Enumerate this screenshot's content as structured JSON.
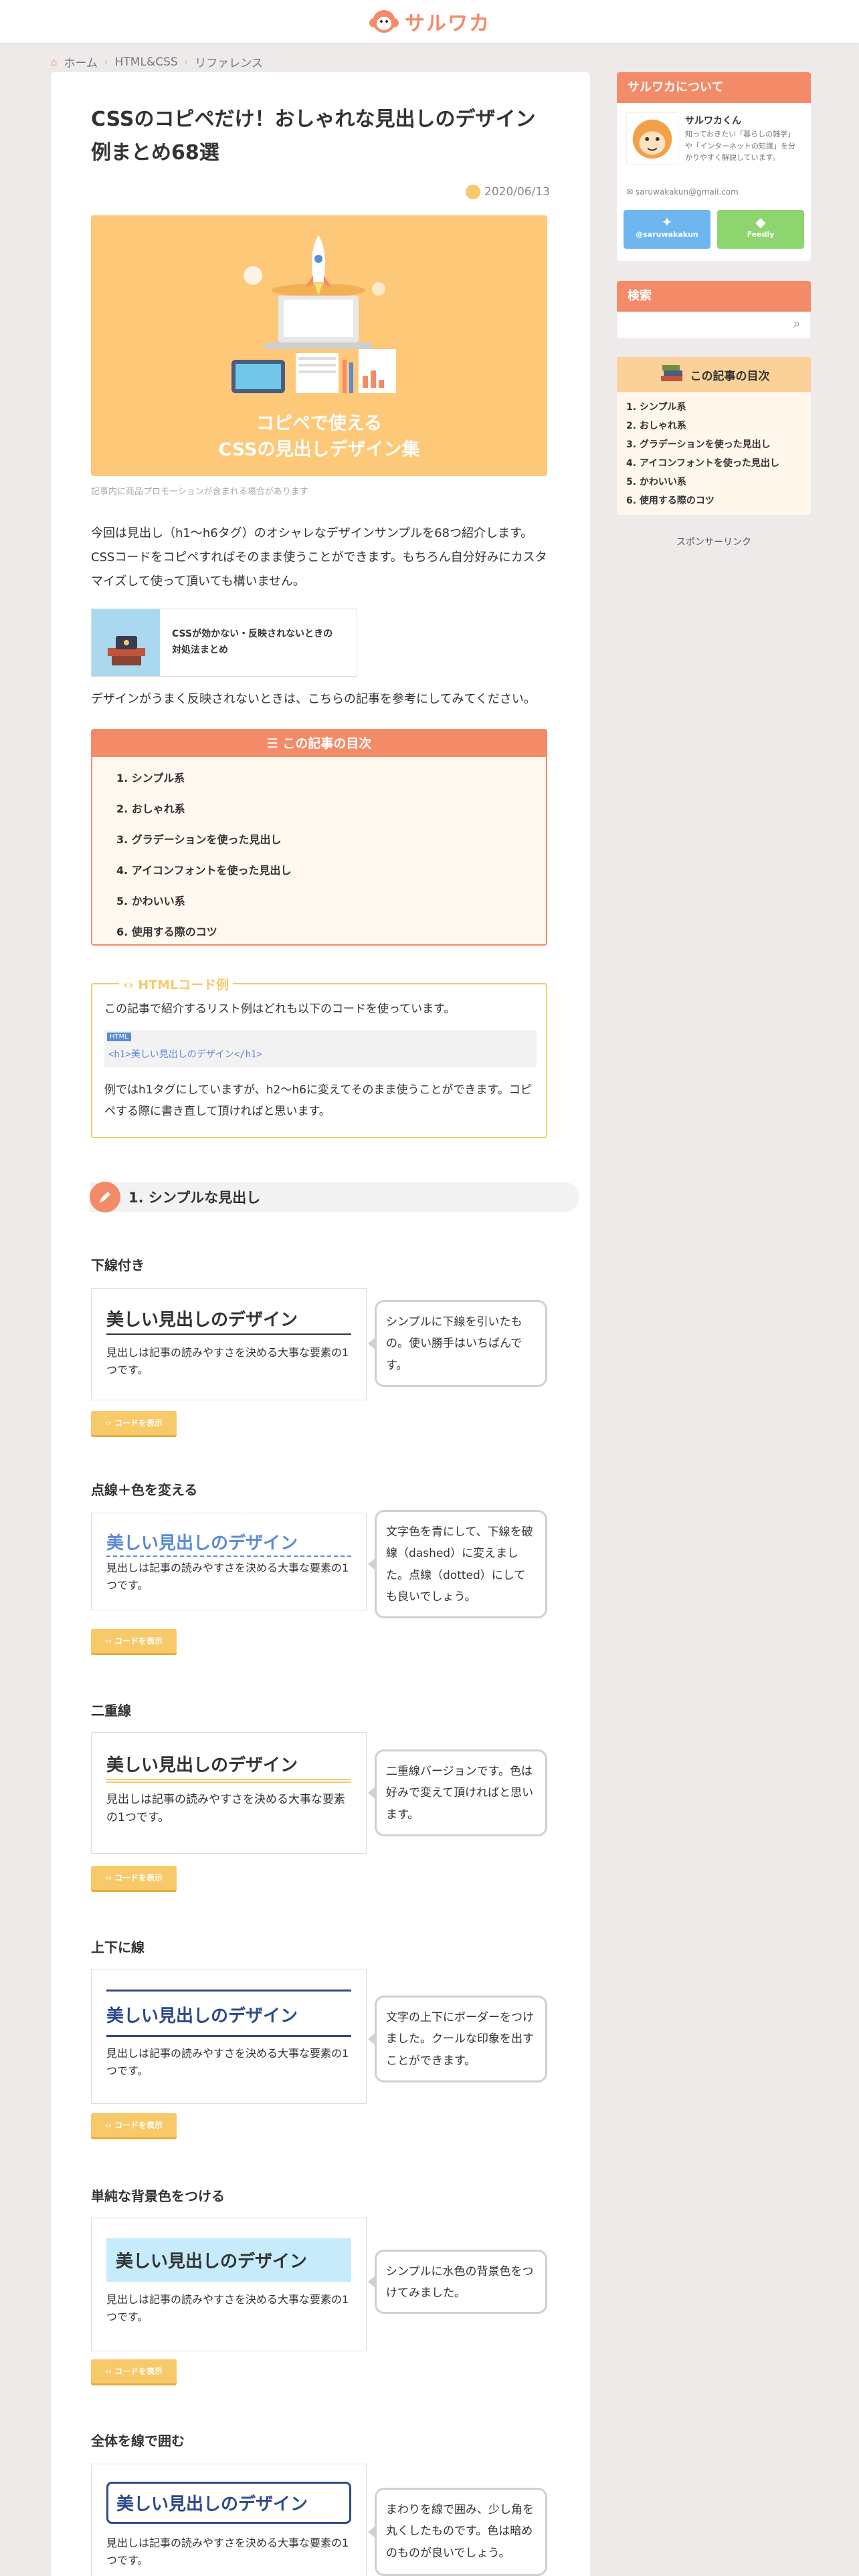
{
  "site": {
    "logo": "サルワカ"
  },
  "breadcrumb": [
    "ホーム",
    "HTML&CSS",
    "リファレンス"
  ],
  "article": {
    "title": "CSSのコピペだけ！おしゃれな見出しのデザイン例まとめ68選",
    "date": "2020/06/13",
    "hero_text": [
      "コピペで使える",
      "CSSの見出しデザイン集"
    ],
    "promo_note": "記事内に商品プロモーションが含まれる場合があります",
    "intro": "今回は見出し（h1〜h6タグ）のオシャレなデザインサンプルを68つ紹介します。CSSコードをコピペすればそのまま使うことができます。もちろん自分好みにカスタマイズして使って頂いても構いません。",
    "related_card": [
      "CSSが効かない・反映されないときの",
      "対処法まとめ"
    ],
    "related_note": "デザインがうまく反映されないときは、こちらの記事を参考にしてみてください。",
    "toc": {
      "heading": "この記事の目次",
      "items": [
        "1. シンプル系",
        "2. おしゃれ系",
        "3. グラデーションを使った見出し",
        "4. アイコンフォントを使った見出し",
        "5. かわいい系",
        "6. 使用する際のコツ"
      ]
    },
    "code_box": {
      "label": "HTMLコード例",
      "text": "この記事で紹介するリスト例はどれも以下のコードを使っています。",
      "tag": "HTML",
      "code": "<h1>美しい見出しのデザイン</h1>",
      "note": "例ではh1タグにしていますが、h2〜h6に変えてそのまま使うことができます。コピペする際に書き直して頂ければと思います。"
    },
    "section1": {
      "heading": "1. シンプルな見出し"
    },
    "demo_title": "美しい見出しのデザイン",
    "demo_text": "見出しは記事の読みやすさを決める大事な要素の1つです。",
    "button_label": "コードを表示",
    "examples": [
      {
        "heading": "下線付き",
        "bubble": "シンプルに下線を引いたもの。使い勝手はいちばんです。"
      },
      {
        "heading": "点線＋色を変える",
        "bubble": "文字色を青にして、下線を破線（dashed）に変えました。点線（dotted）にしても良いでしょう。"
      },
      {
        "heading": "二重線",
        "bubble": "二重線バージョンです。色は好みで変えて頂ければと思います。"
      },
      {
        "heading": "上下に線",
        "bubble": "文字の上下にボーダーをつけました。クールな印象を出すことができます。"
      },
      {
        "heading": "単純な背景色をつける",
        "bubble": "シンプルに水色の背景色をつけてみました。"
      },
      {
        "heading": "全体を線で囲む",
        "bubble": "まわりを線で囲み、少し角を丸くしたものです。色は暗めのものが良いでしょう。"
      }
    ]
  },
  "sidebar": {
    "about": {
      "heading": "サルワカについて",
      "name": "サルワカくん",
      "desc": "知っておきたい「暮らしの雑学」や「インターネットの知識」を分かりやすく解説しています。",
      "email": "saruwakakun@gmail.com",
      "twitter": "@saruwakakun",
      "feedly": "Feedly"
    },
    "search": {
      "heading": "検索",
      "icon": "search-icon"
    },
    "toc": {
      "heading": "この記事の目次",
      "items": [
        "1. シンプル系",
        "2. おしゃれ系",
        "3. グラデーションを使った見出し",
        "4. アイコンフォントを使った見出し",
        "5. かわいい系",
        "6. 使用する際のコツ"
      ]
    },
    "sponsor": "スポンサーリンク"
  },
  "colors": {
    "accent": "#f48b68",
    "yellow": "#f8c968",
    "blue": "#5b8ad6",
    "navy": "#2d4a8a",
    "lightblue": "#c6ecfb"
  }
}
